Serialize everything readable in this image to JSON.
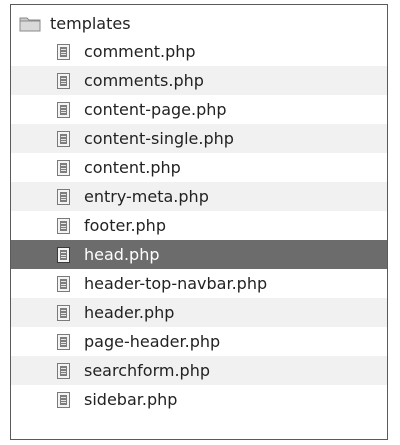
{
  "folder": {
    "name": "templates",
    "icon": "folder-icon"
  },
  "files": [
    {
      "name": "comment.php",
      "icon": "php-file-icon",
      "selected": false
    },
    {
      "name": "comments.php",
      "icon": "php-file-icon",
      "selected": false
    },
    {
      "name": "content-page.php",
      "icon": "php-file-icon",
      "selected": false
    },
    {
      "name": "content-single.php",
      "icon": "php-file-icon",
      "selected": false
    },
    {
      "name": "content.php",
      "icon": "php-file-icon",
      "selected": false
    },
    {
      "name": "entry-meta.php",
      "icon": "php-file-icon",
      "selected": false
    },
    {
      "name": "footer.php",
      "icon": "php-file-icon",
      "selected": false
    },
    {
      "name": "head.php",
      "icon": "php-file-icon",
      "selected": true
    },
    {
      "name": "header-top-navbar.php",
      "icon": "php-file-icon",
      "selected": false
    },
    {
      "name": "header.php",
      "icon": "php-file-icon",
      "selected": false
    },
    {
      "name": "page-header.php",
      "icon": "php-file-icon",
      "selected": false
    },
    {
      "name": "searchform.php",
      "icon": "php-file-icon",
      "selected": false
    },
    {
      "name": "sidebar.php",
      "icon": "php-file-icon",
      "selected": false
    }
  ],
  "colors": {
    "selected_row": "#6c6c6c",
    "alternate_row": "#f1f1f1"
  }
}
